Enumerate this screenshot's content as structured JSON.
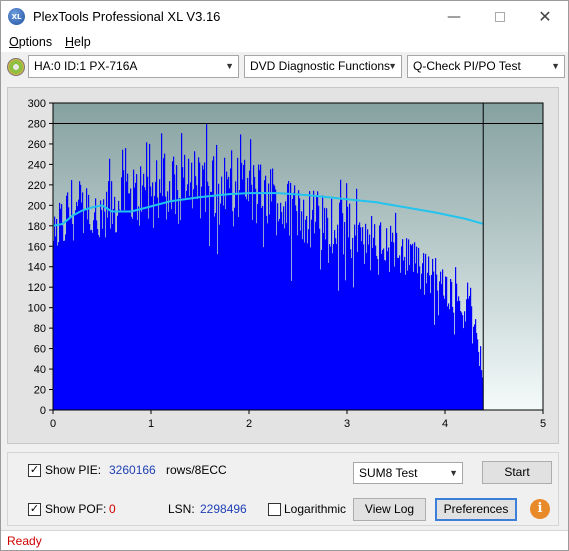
{
  "window": {
    "title": "PlexTools Professional XL V3.16",
    "icon_text": "XL"
  },
  "menubar": {
    "items": [
      {
        "label": "Options",
        "accel": "O"
      },
      {
        "label": "Help",
        "accel": "H"
      }
    ]
  },
  "toolbar": {
    "drive": "HA:0 ID:1  PX-716A",
    "function": "DVD Diagnostic Functions",
    "test": "Q-Check PI/PO Test"
  },
  "chart_data": {
    "type": "area",
    "title": "",
    "xlabel": "",
    "ylabel": "",
    "xlim": [
      0,
      5
    ],
    "ylim": [
      0,
      300
    ],
    "x_ticks": [
      "0",
      "1",
      "2",
      "3",
      "4",
      "5"
    ],
    "y_ticks": [
      "0",
      "20",
      "40",
      "60",
      "80",
      "100",
      "120",
      "140",
      "160",
      "180",
      "200",
      "220",
      "240",
      "260",
      "280",
      "300"
    ],
    "limit_line": 280,
    "end_marker_x": 4.39,
    "colors": {
      "pie_fill": "#0000ff",
      "speed_line": "#22c4ee",
      "plot_bg_top": "#86a1a1",
      "plot_bg_bottom": "#f4fafa"
    },
    "series": [
      {
        "kind": "envelope",
        "x": [
          0,
          0.05,
          0.1,
          0.2,
          0.3,
          0.4,
          0.5,
          0.55,
          0.6,
          0.7,
          0.8,
          0.9,
          1.0,
          1.1,
          1.2,
          1.3,
          1.4,
          1.5,
          1.6,
          1.7,
          1.8,
          1.9,
          2.0,
          2.1,
          2.2,
          2.3,
          2.4,
          2.5,
          2.6,
          2.7,
          2.8,
          2.9,
          3.0,
          3.1,
          3.2,
          3.3,
          3.4,
          3.5,
          3.6,
          3.7,
          3.8,
          3.9,
          4.0,
          4.1,
          4.2,
          4.25,
          4.3,
          4.35,
          4.38,
          4.39
        ],
        "values": [
          180,
          210,
          215,
          230,
          225,
          215,
          205,
          230,
          225,
          235,
          240,
          245,
          240,
          250,
          255,
          250,
          255,
          260,
          258,
          262,
          255,
          250,
          245,
          245,
          240,
          235,
          228,
          225,
          220,
          215,
          212,
          210,
          205,
          200,
          195,
          190,
          185,
          178,
          170,
          165,
          155,
          150,
          140,
          130,
          120,
          112,
          105,
          70,
          40,
          0
        ]
      },
      {
        "name": "",
        "kind": "speed",
        "x": [
          0,
          0.1,
          0.2,
          0.3,
          0.4,
          0.5,
          0.6,
          0.8,
          1.0,
          1.2,
          1.5,
          1.8,
          2.0,
          2.3,
          2.6,
          3.0,
          3.3,
          3.6,
          3.9,
          4.2,
          4.39
        ],
        "values": [
          180,
          182,
          190,
          195,
          198,
          200,
          194,
          194,
          199,
          204,
          208,
          211,
          212,
          212,
          210,
          206,
          203,
          198,
          193,
          187,
          182
        ]
      }
    ]
  },
  "controls": {
    "show_pie_label": "Show PIE:",
    "show_pie_checked": "✓",
    "pie_value": "3260166",
    "pie_unit": "rows/8ECC",
    "show_pof_label": "Show POF:",
    "show_pof_checked": "✓",
    "pof_value": "0",
    "lsn_label": "LSN:",
    "lsn_value": "2298496",
    "log_label": "Logarithmic",
    "test_select": "SUM8 Test",
    "start_btn": "Start",
    "viewlog_btn": "View Log",
    "prefs_btn": "Preferences"
  },
  "status": {
    "text": "Ready"
  }
}
